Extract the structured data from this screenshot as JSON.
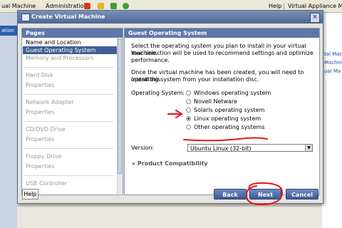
{
  "app": {
    "menu": [
      "ual Machine",
      "Administration"
    ],
    "menu_right": [
      "Help",
      "Virtual Appliance Ma"
    ],
    "left_tab": "ation",
    "right_panel_links": [
      "tal Mac",
      "Machin",
      "ual Ma"
    ]
  },
  "dialog": {
    "title": "Create Virtual Machine",
    "close_glyph": "×",
    "pages_header": "Pages",
    "pages": [
      {
        "label": "Name and Location",
        "state": "done"
      },
      {
        "label": "Guest Operating System",
        "state": "selected"
      },
      {
        "label": "Memory and Processors",
        "state": "disabled"
      },
      {
        "label": "Hard Disk",
        "state": "disabled"
      },
      {
        "label": "Properties",
        "state": "disabled"
      },
      {
        "label": "Network Adapter",
        "state": "disabled"
      },
      {
        "label": "Properties",
        "state": "disabled"
      },
      {
        "label": "CD/DVD Drive",
        "state": "disabled"
      },
      {
        "label": "Properties",
        "state": "disabled"
      },
      {
        "label": "Floppy Drive",
        "state": "disabled"
      },
      {
        "label": "Properties",
        "state": "disabled"
      },
      {
        "label": "USB Controller",
        "state": "disabled"
      }
    ],
    "content_header": "Guest Operating System",
    "intro_line1": "Select the operating system you plan to install in your virtual machine.",
    "intro_line2": "Your selection will be used to recommend settings and optimize",
    "intro_line3": "performance.",
    "after_line1": "Once the virtual machine has been created, you will need to install this",
    "after_line2": "operating system from your installation disc.",
    "os_label": "Operating System:",
    "os_options": [
      {
        "label": "Windows operating system",
        "checked": false
      },
      {
        "label": "Novell Netware",
        "checked": false
      },
      {
        "label": "Solaris operating system",
        "checked": false
      },
      {
        "label": "Linux operating system",
        "checked": true
      },
      {
        "label": "Other operating systems",
        "checked": false
      }
    ],
    "version_label": "Version:",
    "version_value": "Ubuntu Linux (32-bit)",
    "compat_label": "Product Compatibility",
    "buttons": {
      "help": "Help",
      "back": "Back",
      "next": "Next",
      "cancel": "Cancel"
    }
  },
  "colors": {
    "accent": "#3e5f96",
    "annotation": "#e8141a"
  },
  "icons": [
    "vm-window-icon",
    "close-icon",
    "dropdown-arrow-icon",
    "expand-arrow-icon"
  ]
}
